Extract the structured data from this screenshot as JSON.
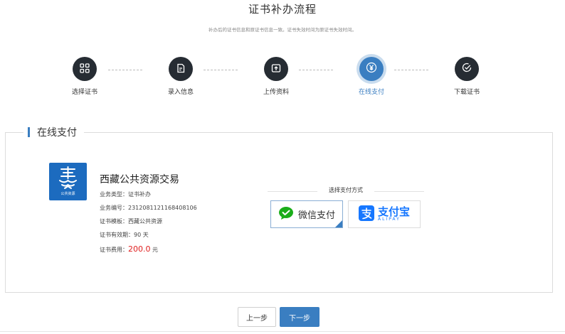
{
  "page": {
    "title": "证书补办流程",
    "subtitle": "补办后的证书信息和原证书信息一致。证书失效时间为原证书失效时间。"
  },
  "steps": [
    {
      "label": "选择证书",
      "icon": "grid-icon",
      "active": false
    },
    {
      "label": "录入信息",
      "icon": "edit-document-icon",
      "active": false
    },
    {
      "label": "上传资料",
      "icon": "upload-icon",
      "active": false
    },
    {
      "label": "在线支付",
      "icon": "yen-icon",
      "active": true
    },
    {
      "label": "下载证书",
      "icon": "check-circle-icon",
      "active": false
    }
  ],
  "section": {
    "title": "在线支付"
  },
  "org": {
    "logo_caption": "公共资源",
    "name": "西藏公共资源交易"
  },
  "details": {
    "business_type_label": "业务类型：",
    "business_type_value": "证书补办",
    "business_no_label": "业务编号：",
    "business_no_value": "2312081121168408106",
    "template_label": "证书模板：",
    "template_value": "西藏公共资源",
    "validity_label": "证书有效期：",
    "validity_value": "90 天",
    "fee_label": "证书费用：",
    "fee_value": "200.0",
    "fee_unit": "元"
  },
  "payment": {
    "choose_label": "选择支付方式",
    "wechat_label": "微信支付",
    "alipay_label": "支付宝",
    "alipay_sub": "ALIPAY",
    "selected": "wechat"
  },
  "buttons": {
    "prev": "上一步",
    "next": "下一步"
  },
  "colors": {
    "accent": "#3a7ec1",
    "step_dark": "#262c33",
    "fee": "#e02020",
    "wechat": "#1aad19",
    "alipay": "#1677ff"
  }
}
